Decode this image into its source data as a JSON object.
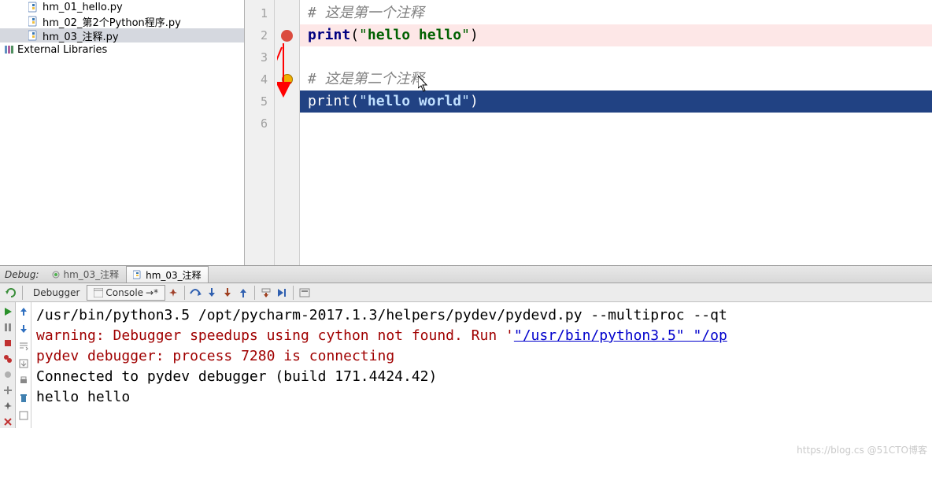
{
  "sidebar": {
    "files": [
      {
        "name": "hm_01_hello.py",
        "selected": false
      },
      {
        "name": "hm_02_第2个Python程序.py",
        "selected": false
      },
      {
        "name": "hm_03_注释.py",
        "selected": true
      }
    ],
    "external_libraries": "External Libraries"
  },
  "editor": {
    "lines": [
      "# 这是第一个注释",
      "print(\"hello hello\")",
      "",
      "# 这是第二个注释",
      "print(\"hello world\")",
      ""
    ],
    "line_numbers": [
      "1",
      "2",
      "3",
      "4",
      "5",
      "6"
    ]
  },
  "debug_tabbar": {
    "label": "Debug:",
    "tab1": "hm_03_注释",
    "tab2": "hm_03_注释"
  },
  "toolbar": {
    "debugger": "Debugger",
    "console": "Console"
  },
  "console": {
    "line0": "/usr/bin/python3.5 /opt/pycharm-2017.1.3/helpers/pydev/pydevd.py --multiproc --qt",
    "line1_a": "warning: Debugger speedups using cython not found. Run '",
    "line1_b": "\"/usr/bin/python3.5\" \"/op",
    "line2": "pydev debugger: process 7280 is connecting",
    "line3": "",
    "line4": "Connected to pydev debugger (build 171.4424.42)",
    "line5": "hello hello"
  },
  "watermark": "https://blog.cs @51CTO博客"
}
